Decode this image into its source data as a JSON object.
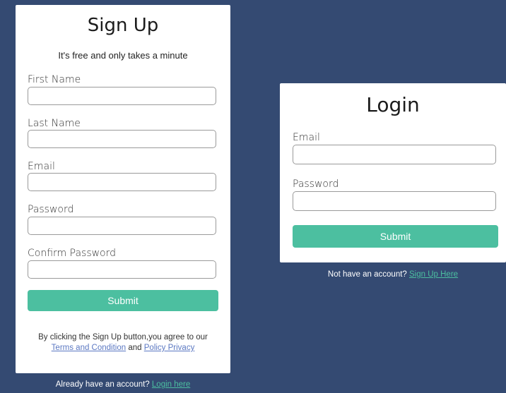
{
  "signup": {
    "title": "Sign Up",
    "subtitle": "It's free and only takes a minute",
    "fields": [
      {
        "label": "First Name",
        "value": ""
      },
      {
        "label": "Last Name",
        "value": ""
      },
      {
        "label": "Email",
        "value": ""
      },
      {
        "label": "Password",
        "value": ""
      },
      {
        "label": "Confirm Password",
        "value": ""
      }
    ],
    "submit_label": "Submit",
    "terms_prefix": "By clicking the Sign Up button,you agree to our",
    "terms_link": "Terms and Condition",
    "terms_and": "and",
    "privacy_link": "Policy Privacy",
    "footer_text": "Already have an account?",
    "footer_link": "Login here"
  },
  "login": {
    "title": "Login",
    "fields": [
      {
        "label": "Email",
        "value": ""
      },
      {
        "label": "Password",
        "value": ""
      }
    ],
    "submit_label": "Submit",
    "footer_text": "Not have an account?",
    "footer_link": "Sign Up Here"
  },
  "colors": {
    "background": "#344a72",
    "accent": "#4cbfa0",
    "link": "#5b78c2"
  }
}
